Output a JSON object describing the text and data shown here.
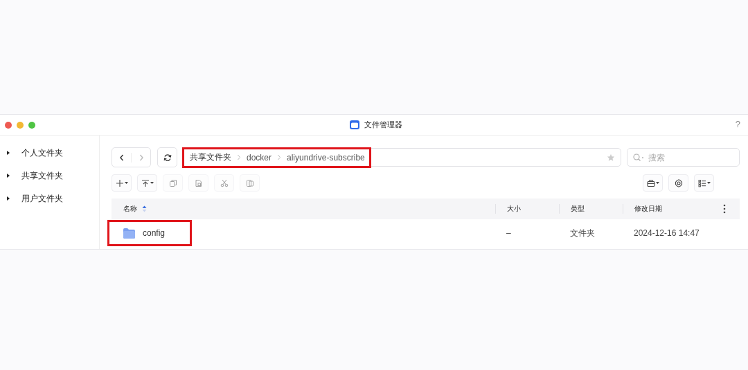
{
  "window": {
    "title": "文件管理器",
    "help": "?"
  },
  "sidebar": {
    "items": [
      {
        "label": "个人文件夹",
        "expanded": false
      },
      {
        "label": "共享文件夹",
        "expanded": false
      },
      {
        "label": "用户文件夹",
        "expanded": false
      }
    ]
  },
  "navigation": {
    "back_disabled": false,
    "forward_disabled": true
  },
  "breadcrumb": {
    "highlighted": true,
    "parts": [
      "共享文件夹",
      "docker",
      "aliyundrive-subscribe"
    ],
    "favorite": false
  },
  "search": {
    "placeholder": "搜索"
  },
  "toolbar_left": [
    {
      "kind": "plus",
      "dropdown": true,
      "disabled": false
    },
    {
      "kind": "upload",
      "dropdown": true,
      "disabled": false
    },
    {
      "kind": "copy",
      "dropdown": false,
      "disabled": true
    },
    {
      "kind": "paste",
      "dropdown": false,
      "disabled": true
    },
    {
      "kind": "cut",
      "dropdown": false,
      "disabled": true
    },
    {
      "kind": "move",
      "dropdown": false,
      "disabled": true
    }
  ],
  "toolbar_right": [
    {
      "kind": "briefcase",
      "dropdown": true
    },
    {
      "kind": "gear",
      "dropdown": false
    },
    {
      "kind": "list",
      "dropdown": true
    }
  ],
  "table": {
    "columns": [
      {
        "label": "名称",
        "sorted": true
      },
      {
        "label": "大小",
        "sorted": false
      },
      {
        "label": "类型",
        "sorted": false
      },
      {
        "label": "修改日期",
        "sorted": false
      }
    ],
    "rows": [
      {
        "name": "config",
        "highlighted": true,
        "size": "–",
        "type": "文件夹",
        "modified": "2024-12-16 14:47"
      }
    ]
  }
}
